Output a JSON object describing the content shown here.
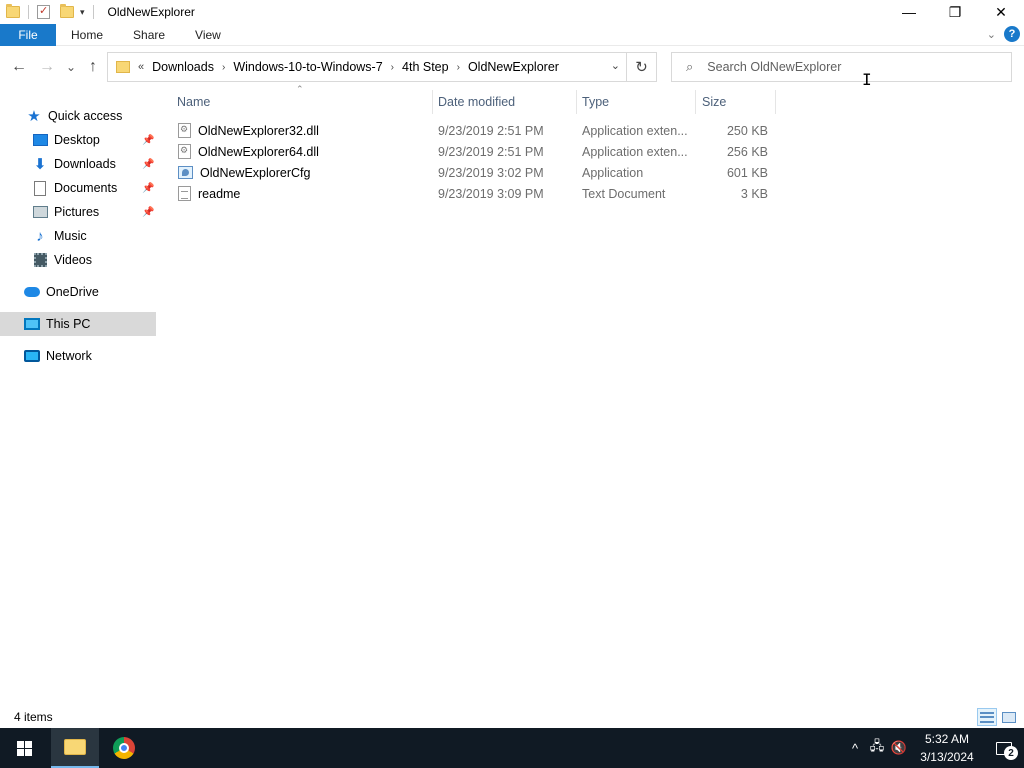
{
  "window": {
    "title": "OldNewExplorer",
    "controls": {
      "minimize": "—",
      "maximize": "❐",
      "close": "✕"
    },
    "quick_access_dropdown": "▾"
  },
  "ribbon": {
    "tabs": [
      {
        "label": "File"
      },
      {
        "label": "Home"
      },
      {
        "label": "Share"
      },
      {
        "label": "View"
      }
    ],
    "expand_icon": "chevron-down-icon",
    "help_label": "?"
  },
  "navbar": {
    "back": "←",
    "forward": "→",
    "recent": "⌄",
    "up": "↑",
    "overflow": "«",
    "breadcrumbs": [
      "Downloads",
      "Windows-10-to-Windows-7",
      "4th Step",
      "OldNewExplorer"
    ],
    "crumb_separator": "›",
    "address_dropdown": "⌄",
    "refresh": "↻"
  },
  "search": {
    "placeholder": "Search OldNewExplorer",
    "value": "",
    "icon": "⌕"
  },
  "sidebar": {
    "items": [
      {
        "label": "Quick access",
        "icon": "star-icon",
        "pinned": false
      },
      {
        "label": "Desktop",
        "icon": "desktop-icon",
        "pinned": true
      },
      {
        "label": "Downloads",
        "icon": "download-icon",
        "pinned": true
      },
      {
        "label": "Documents",
        "icon": "documents-icon",
        "pinned": true
      },
      {
        "label": "Pictures",
        "icon": "pictures-icon",
        "pinned": true
      },
      {
        "label": "Music",
        "icon": "music-icon",
        "pinned": false
      },
      {
        "label": "Videos",
        "icon": "videos-icon",
        "pinned": false
      },
      {
        "label": "OneDrive",
        "icon": "cloud-icon",
        "pinned": false
      },
      {
        "label": "This PC",
        "icon": "computer-icon",
        "pinned": false,
        "selected": true
      },
      {
        "label": "Network",
        "icon": "network-icon",
        "pinned": false
      }
    ],
    "pin_glyph": "📌"
  },
  "filelist": {
    "columns": [
      "Name",
      "Date modified",
      "Type",
      "Size"
    ],
    "sort_indicator": "⌃",
    "rows": [
      {
        "name": "OldNewExplorer32.dll",
        "date": "9/23/2019 2:51 PM",
        "type": "Application exten...",
        "size": "250 KB",
        "icon": "dll-file-icon"
      },
      {
        "name": "OldNewExplorer64.dll",
        "date": "9/23/2019 2:51 PM",
        "type": "Application exten...",
        "size": "256 KB",
        "icon": "dll-file-icon"
      },
      {
        "name": "OldNewExplorerCfg",
        "date": "9/23/2019 3:02 PM",
        "type": "Application",
        "size": "601 KB",
        "icon": "application-icon"
      },
      {
        "name": "readme",
        "date": "9/23/2019 3:09 PM",
        "type": "Text Document",
        "size": "3 KB",
        "icon": "text-file-icon"
      }
    ]
  },
  "statusbar": {
    "item_count": "4 items"
  },
  "taskbar": {
    "apps": [
      "file-explorer-icon",
      "chrome-icon"
    ],
    "tray": {
      "overflow": "^",
      "network": "🖧",
      "volume": "🔇"
    },
    "clock": {
      "time": "5:32 AM",
      "date": "3/13/2024"
    },
    "notification_count": "2"
  },
  "cursor": "I",
  "colors": {
    "accent": "#1979ca",
    "taskbar": "#101a24",
    "selection": "#d9d9d9",
    "column_header": "#4c607a"
  }
}
